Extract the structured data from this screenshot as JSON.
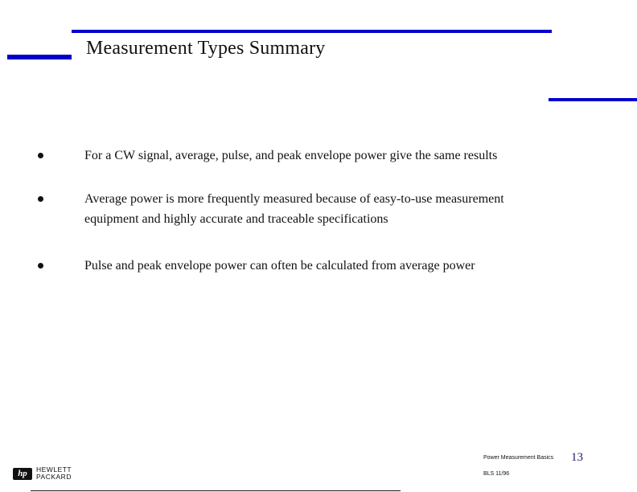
{
  "slide": {
    "title": "Measurement Types Summary",
    "bullets": [
      "For a CW signal, average, pulse, and peak envelope power give the same results",
      "Average power is more frequently measured because of easy-to-use measurement equipment and highly accurate and traceable specifications",
      "Pulse and peak envelope power can often be calculated from average power"
    ],
    "accent_color": "#0000cc"
  },
  "footer": {
    "course_title": "Power Measurement Basics",
    "page_number": "13",
    "code": "BLS  11/96",
    "logo": {
      "mark": "hp",
      "line1": "HEWLETT",
      "line2": "PACKARD"
    }
  }
}
